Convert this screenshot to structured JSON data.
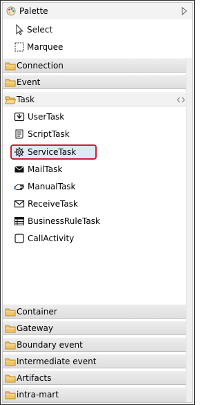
{
  "header": {
    "title": "Palette"
  },
  "tools": [
    {
      "label": "Select",
      "icon": "select-arrow-icon"
    },
    {
      "label": "Marquee",
      "icon": "marquee-icon"
    }
  ],
  "drawers_top": [
    {
      "label": "Connection"
    },
    {
      "label": "Event"
    }
  ],
  "task_drawer": {
    "label": "Task",
    "items": [
      {
        "label": "UserTask",
        "icon": "user-task-icon"
      },
      {
        "label": "ScriptTask",
        "icon": "script-task-icon"
      },
      {
        "label": "ServiceTask",
        "icon": "service-task-gear-icon",
        "selected": true
      },
      {
        "label": "MailTask",
        "icon": "mail-task-icon"
      },
      {
        "label": "ManualTask",
        "icon": "manual-task-hand-icon"
      },
      {
        "label": "ReceiveTask",
        "icon": "receive-task-envelope-icon"
      },
      {
        "label": "BusinessRuleTask",
        "icon": "business-rule-table-icon"
      },
      {
        "label": "CallActivity",
        "icon": "call-activity-icon"
      }
    ]
  },
  "drawers_bottom": [
    {
      "label": "Container"
    },
    {
      "label": "Gateway"
    },
    {
      "label": "Boundary event"
    },
    {
      "label": "Intermediate event"
    },
    {
      "label": "Artifacts"
    },
    {
      "label": "intra-mart"
    }
  ],
  "colors": {
    "selection_fill": "#dbe9fb",
    "selection_outline": "#cc1f2b",
    "folder": "#f2c46a"
  }
}
